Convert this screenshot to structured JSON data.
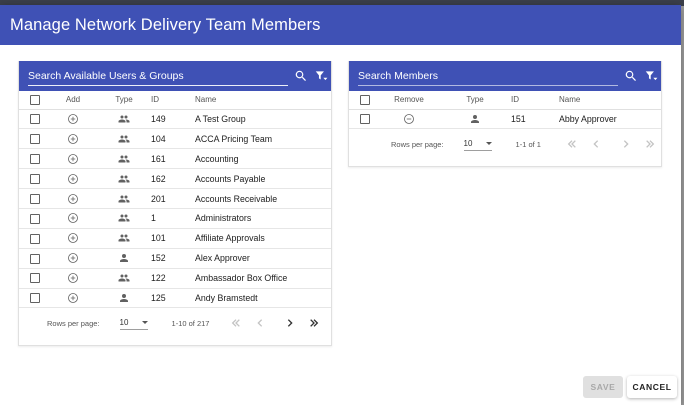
{
  "dialog": {
    "title": "Manage Network Delivery Team Members"
  },
  "available": {
    "search_placeholder": "Search Available Users & Groups",
    "columns": {
      "add": "Add",
      "type": "Type",
      "id": "ID",
      "name": "Name"
    },
    "rows": [
      {
        "type": "group",
        "id": "149",
        "name": "A Test Group"
      },
      {
        "type": "group",
        "id": "104",
        "name": "ACCA Pricing Team"
      },
      {
        "type": "group",
        "id": "161",
        "name": "Accounting"
      },
      {
        "type": "group",
        "id": "162",
        "name": "Accounts Payable"
      },
      {
        "type": "group",
        "id": "201",
        "name": "Accounts Receivable"
      },
      {
        "type": "group",
        "id": "1",
        "name": "Administrators"
      },
      {
        "type": "group",
        "id": "101",
        "name": "Affiliate Approvals"
      },
      {
        "type": "user",
        "id": "152",
        "name": "Alex Approver"
      },
      {
        "type": "group",
        "id": "122",
        "name": "Ambassador Box Office"
      },
      {
        "type": "user",
        "id": "125",
        "name": "Andy Bramstedt"
      }
    ],
    "pager": {
      "rows_per_page_label": "Rows per page:",
      "rows_per_page": "10",
      "range": "1-10 of 217"
    }
  },
  "members": {
    "search_placeholder": "Search Members",
    "columns": {
      "remove": "Remove",
      "type": "Type",
      "id": "ID",
      "name": "Name"
    },
    "rows": [
      {
        "type": "user",
        "id": "151",
        "name": "Abby Approver"
      }
    ],
    "pager": {
      "rows_per_page_label": "Rows per page:",
      "rows_per_page": "10",
      "range": "1-1 of 1"
    }
  },
  "footer": {
    "save_label": "SAVE",
    "cancel_label": "CANCEL"
  },
  "colors": {
    "primary": "#3f51b5",
    "icon": "#616161"
  }
}
